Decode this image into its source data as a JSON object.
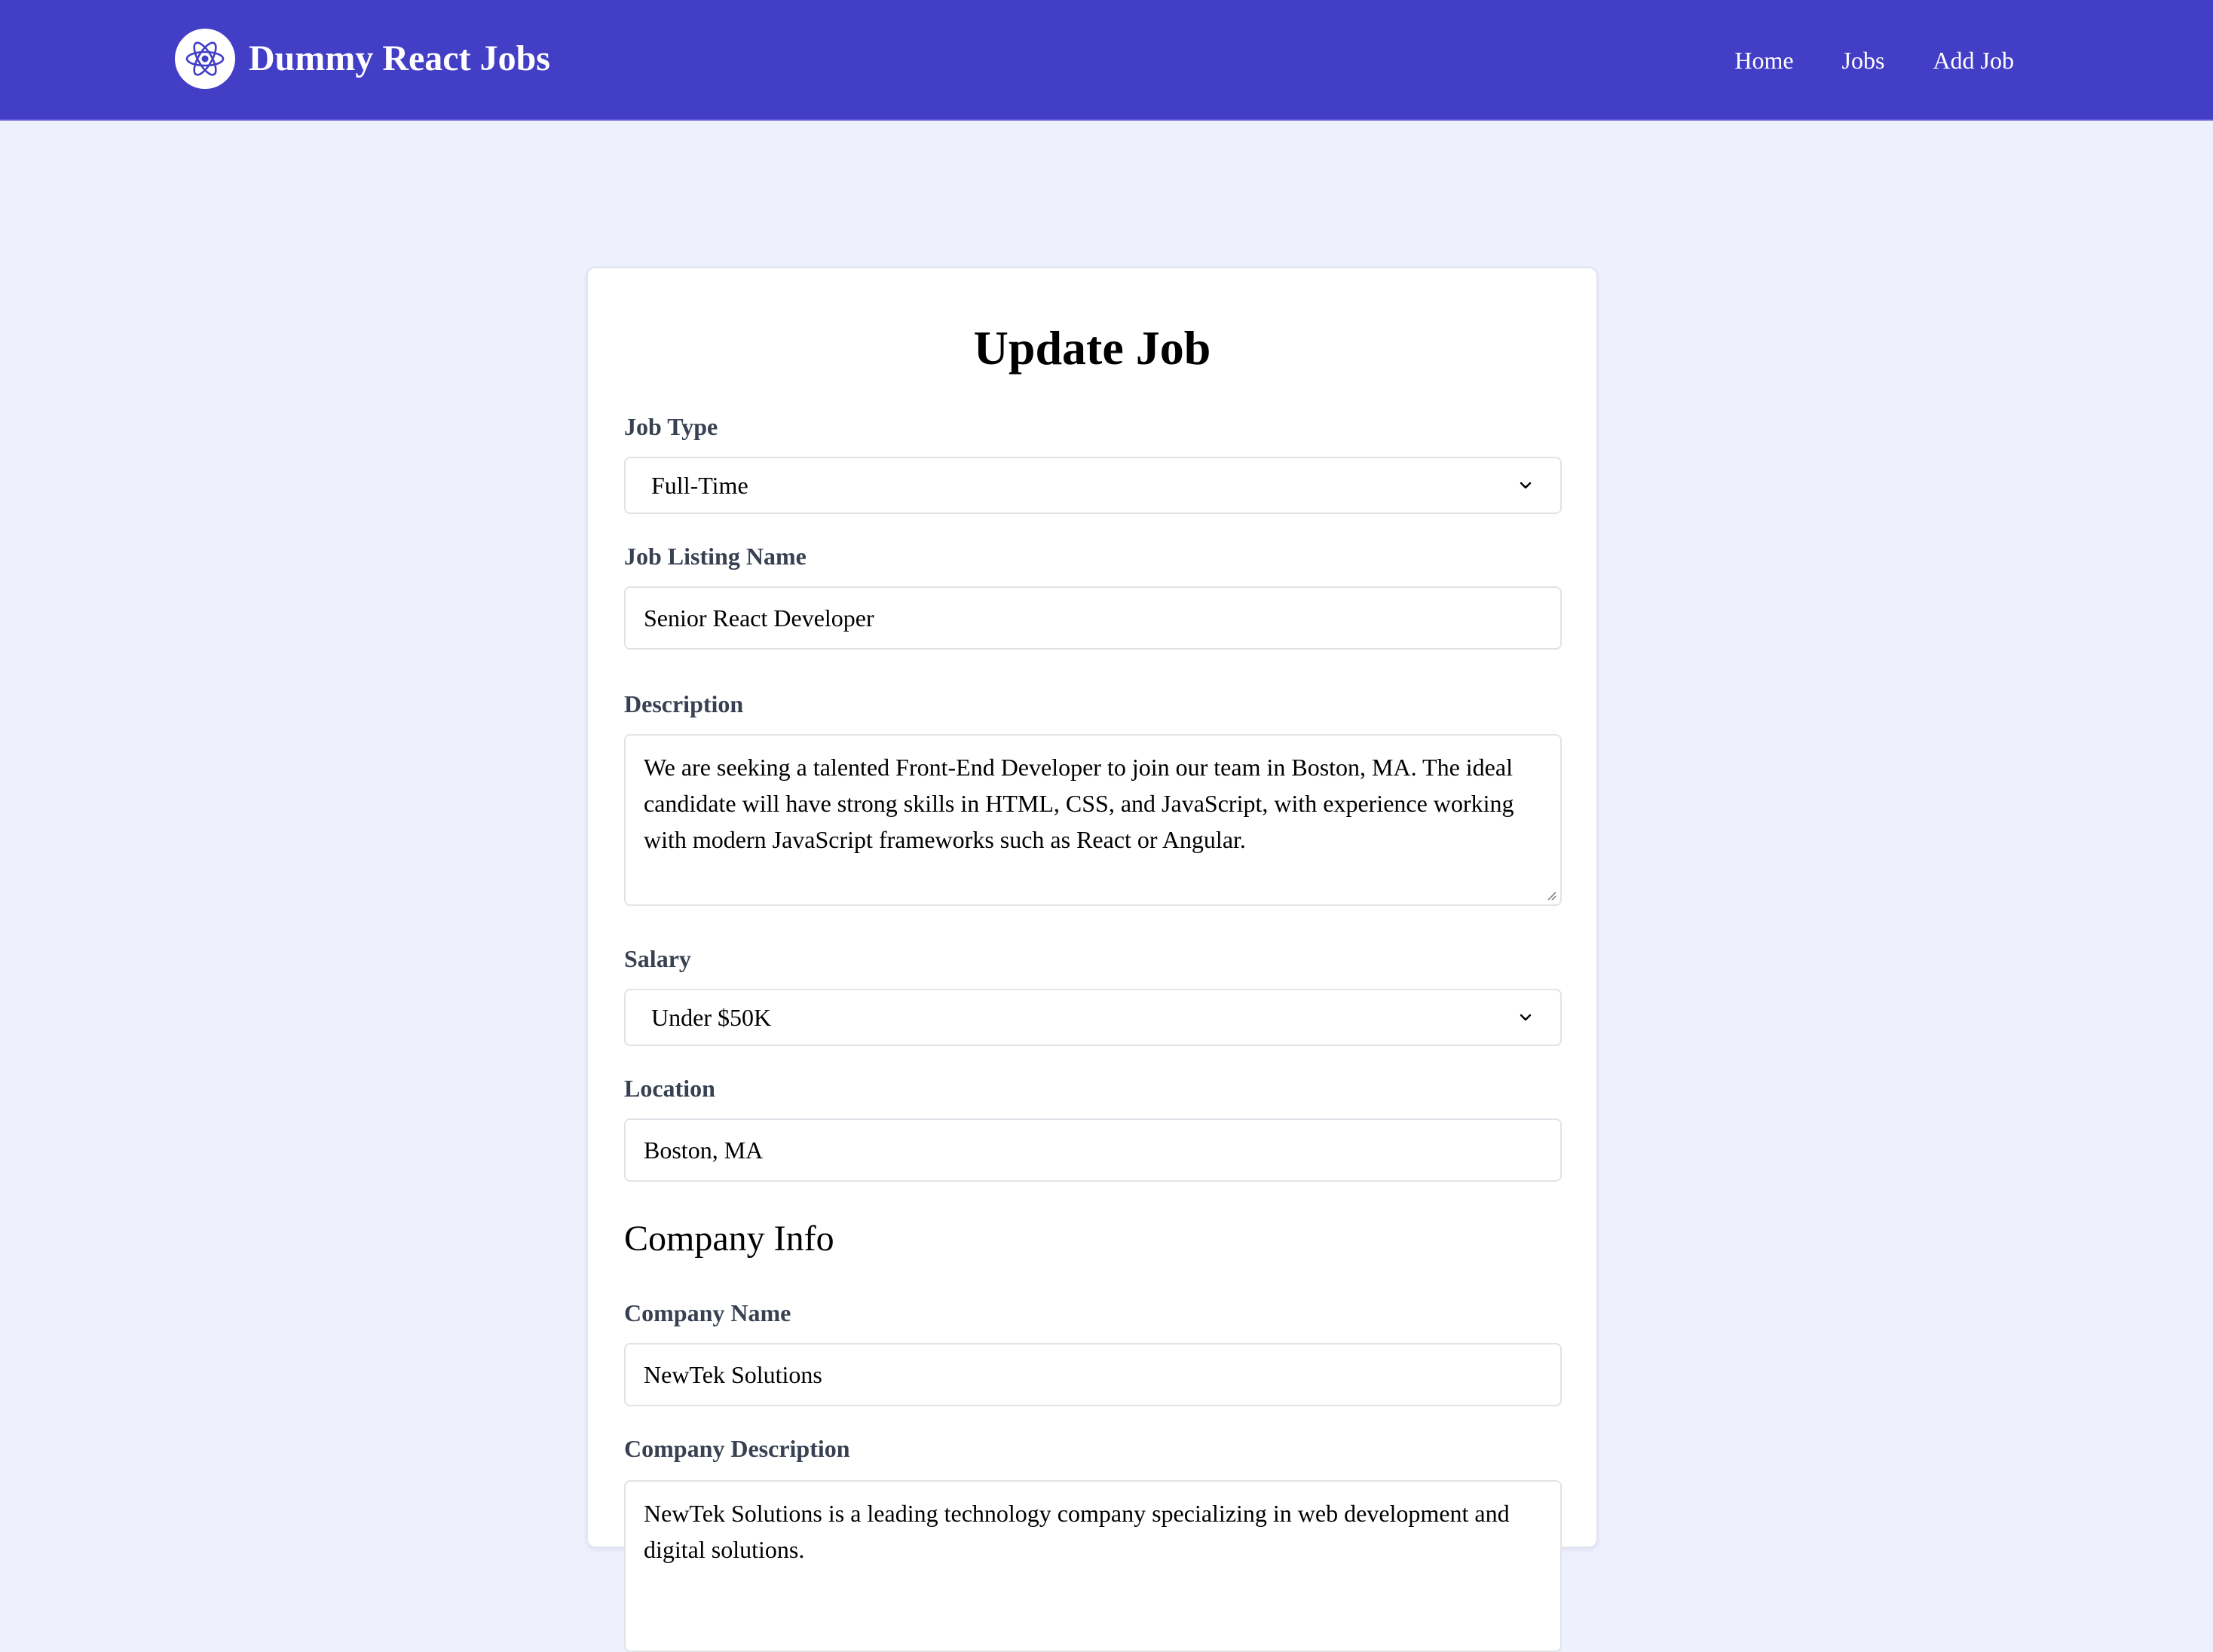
{
  "navbar": {
    "brand": "Dummy React Jobs",
    "logo_icon": "react-atom-icon",
    "links": [
      "Home",
      "Jobs",
      "Add Job"
    ]
  },
  "form": {
    "title": "Update Job",
    "job_type": {
      "label": "Job Type",
      "value": "Full-Time"
    },
    "job_name": {
      "label": "Job Listing Name",
      "value": "Senior React Developer"
    },
    "description": {
      "label": "Description",
      "value": "We are seeking a talented Front-End Developer to join our team in Boston, MA. The ideal candidate will have strong skills in HTML, CSS, and JavaScript, with experience working with modern JavaScript frameworks such as React or Angular."
    },
    "salary": {
      "label": "Salary",
      "value": "Under $50K"
    },
    "location": {
      "label": "Location",
      "value": "Boston, MA"
    },
    "company_section": "Company Info",
    "company_name": {
      "label": "Company Name",
      "value": "NewTek Solutions"
    },
    "company_description": {
      "label": "Company Description",
      "value": "NewTek Solutions is a leading technology company specializing in web development and digital solutions."
    }
  },
  "colors": {
    "navbar": "#433ec6",
    "page_background": "#eef0fe",
    "label_text": "#374151"
  }
}
